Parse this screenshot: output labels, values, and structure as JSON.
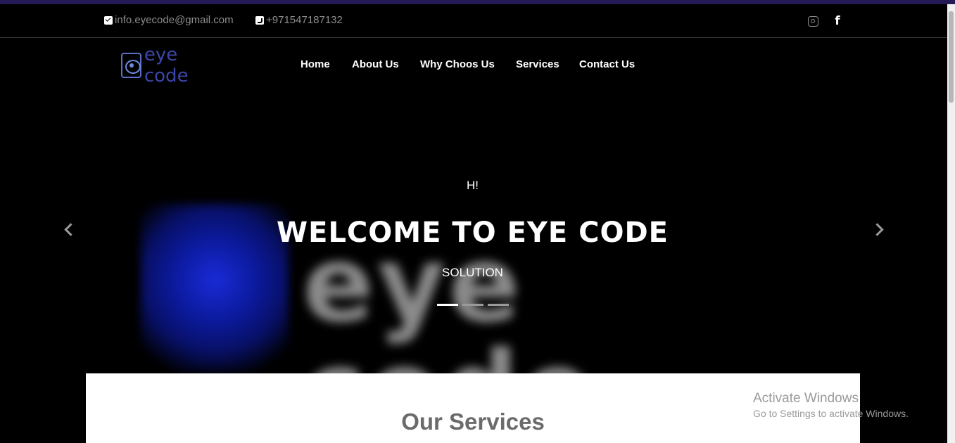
{
  "topbar": {
    "email": "info.eyecode@gmail.com",
    "phone": "+971547187132",
    "social": [
      {
        "icon": "instagram-icon"
      },
      {
        "icon": "facebook-icon",
        "glyph": "f"
      }
    ]
  },
  "logo": {
    "text": "eye code",
    "color": "#3c46a8"
  },
  "nav": {
    "items": [
      "Home",
      "About Us",
      "Why Choos Us",
      "Services",
      "Contact Us"
    ]
  },
  "hero": {
    "small": "H!",
    "title": "WELCOME TO EYE CODE",
    "subtitle": "SOLUTION",
    "background_word": "eye code",
    "slide_count": 3,
    "active_slide": 1
  },
  "services": {
    "title": "Our Services"
  },
  "watermark": {
    "line1": "Activate Windows",
    "line2": "Go to Settings to activate Windows."
  }
}
